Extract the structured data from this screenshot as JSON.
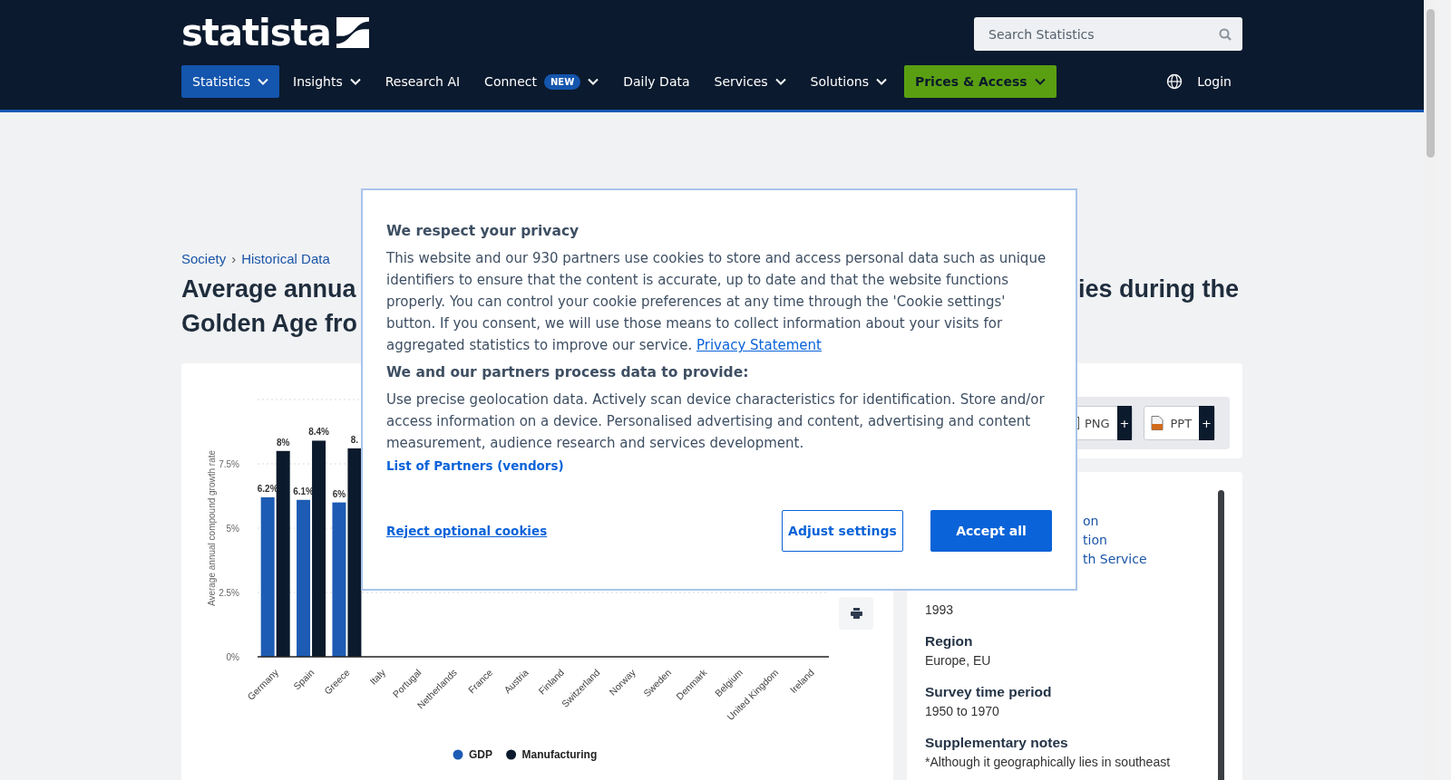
{
  "header": {
    "logo": "statista",
    "search": {
      "placeholder": "Search Statistics"
    },
    "nav": [
      {
        "label": "Statistics",
        "selected": true,
        "dropdown": true,
        "kind": "plain"
      },
      {
        "label": "Insights",
        "selected": false,
        "dropdown": true,
        "kind": "plain"
      },
      {
        "label": "Research AI",
        "selected": false,
        "dropdown": false,
        "kind": "plain"
      },
      {
        "label": "Connect",
        "badge": "NEW",
        "selected": false,
        "dropdown": true,
        "kind": "plain"
      },
      {
        "label": "Daily Data",
        "selected": false,
        "dropdown": false,
        "kind": "plain"
      },
      {
        "label": "Services",
        "selected": false,
        "dropdown": true,
        "kind": "plain"
      },
      {
        "label": "Solutions",
        "selected": false,
        "dropdown": true,
        "kind": "plain"
      },
      {
        "label": "Prices & Access",
        "selected": false,
        "dropdown": true,
        "kind": "accent"
      }
    ],
    "login": "Login"
  },
  "breadcrumb": {
    "items": [
      "Society",
      "Historical Data"
    ],
    "separator": "›"
  },
  "title": {
    "line_1_start": "Average annua",
    "line_1_end": "ies during the",
    "line_2_start": "Golden Age fro"
  },
  "chart": {
    "chart_data": {
      "type": "bar",
      "ylabel": "Average annual compound growth rate",
      "categories": [
        "Germany",
        "Spain",
        "Greece",
        "Italy",
        "Portugal",
        "Netherlands",
        "France",
        "Austria",
        "Finland",
        "Switzerland",
        "Norway",
        "Sweden",
        "Denmark",
        "Belgium",
        "United Kingdom",
        "Ireland"
      ],
      "series": [
        {
          "name": "GDP",
          "color": "#1d5cb4",
          "values": [
            6.2,
            6.1,
            6,
            null,
            null,
            null,
            null,
            null,
            null,
            null,
            null,
            null,
            null,
            null,
            null,
            null
          ],
          "value_labels": [
            "6.2%",
            "6.1%",
            "6%",
            null,
            null,
            null,
            null,
            null,
            null,
            null,
            null,
            null,
            null,
            null,
            null,
            null
          ]
        },
        {
          "name": "Manufacturing",
          "color": "#0b1a2c",
          "values": [
            8,
            8.4,
            8.1,
            null,
            null,
            null,
            null,
            null,
            null,
            null,
            null,
            null,
            null,
            null,
            null,
            null
          ],
          "value_labels": [
            "8%",
            "8.4%",
            "8.",
            null,
            null,
            null,
            null,
            null,
            null,
            null,
            null,
            null,
            null,
            null,
            null,
            null
          ]
        }
      ],
      "ylim": [
        0,
        10
      ],
      "yticks": [
        {
          "value": 0,
          "label": "0%"
        },
        {
          "value": 2.5,
          "label": "2.5%"
        },
        {
          "value": 5,
          "label": "5%"
        },
        {
          "value": 7.5,
          "label": "7.5%"
        }
      ],
      "grid": true,
      "legend": true
    }
  },
  "downloads": [
    {
      "label": "PNG",
      "kind": "png",
      "more": "+"
    },
    {
      "label": "PPT",
      "kind": "ppt",
      "more": "+"
    }
  ],
  "info": {
    "link_fragments": [
      "on",
      "tion",
      "th Service"
    ],
    "details": [
      {
        "value": "1993"
      },
      {
        "label": "Region",
        "value": "Europe, EU"
      },
      {
        "label": "Survey time period",
        "value": "1950 to 1970"
      },
      {
        "label": "Supplementary notes",
        "value": "*Although it geographically lies in southeast"
      }
    ]
  },
  "modal": {
    "title": "We respect your privacy",
    "intro": "This website and our 930 partners use cookies to store and access personal data such as unique identifiers to ensure that the content is accurate, up to date and that the website functions properly. You can control your cookie preferences at any time through the 'Cookie settings' button. If you consent, we will use those means to collect information about your visits for aggregated statistics to improve our service.",
    "privacy_link": "Privacy Statement",
    "purposes_title": "We and our partners process data to provide:",
    "purposes": "Use precise geolocation data. Actively scan device characteristics for identification. Store and/or access information on a device. Personalised advertising and content, advertising and content measurement, audience research and services development.",
    "partners_link": "List of Partners (vendors)",
    "reject": "Reject optional cookies",
    "adjust": "Adjust settings",
    "accept": "Accept all"
  }
}
